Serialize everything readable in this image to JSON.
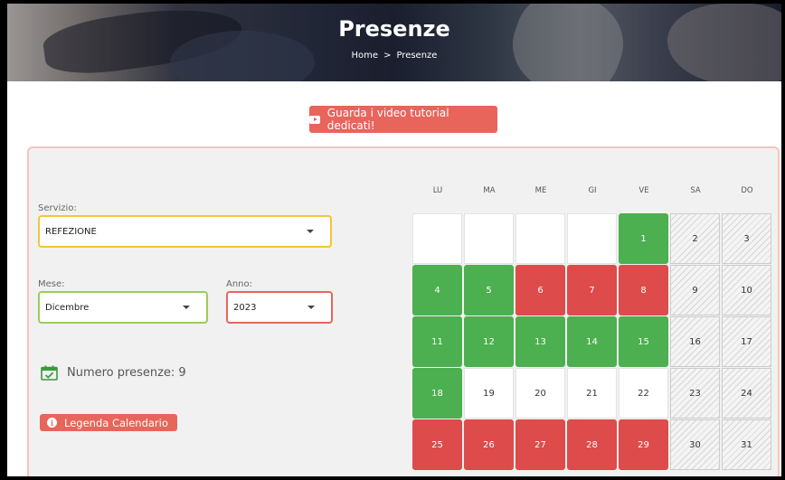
{
  "hero": {
    "title": "Presenze",
    "breadcrumb": {
      "home": "Home",
      "separator": ">",
      "current": "Presenze"
    }
  },
  "tutorial_button": {
    "label": "Guarda i video tutorial dedicati!",
    "icon": "youtube-icon"
  },
  "form": {
    "servizio": {
      "label": "Servizio:",
      "value": "REFEZIONE"
    },
    "mese": {
      "label": "Mese:",
      "value": "Dicembre"
    },
    "anno": {
      "label": "Anno:",
      "value": "2023"
    }
  },
  "presenze": {
    "text": "Numero presenze: 9",
    "icon": "calendar-check-icon"
  },
  "legend_button": {
    "label": "Legenda Calendario",
    "icon": "info-icon"
  },
  "colors": {
    "accent": "#e8655b",
    "present": "#4caf50",
    "absent": "#dd4b4b",
    "servizio_border": "#f5c33b",
    "mese_border": "#9acd5a",
    "anno_border": "#e8655b",
    "card_border": "#f6c5bd"
  },
  "calendar": {
    "weekdays": [
      "LU",
      "MA",
      "ME",
      "GI",
      "VE",
      "SA",
      "DO"
    ],
    "weeks": [
      [
        {
          "d": "",
          "s": "empty"
        },
        {
          "d": "",
          "s": "empty"
        },
        {
          "d": "",
          "s": "empty"
        },
        {
          "d": "",
          "s": "empty"
        },
        {
          "d": "1",
          "s": "green"
        },
        {
          "d": "2",
          "s": "weekend"
        },
        {
          "d": "3",
          "s": "weekend"
        }
      ],
      [
        {
          "d": "4",
          "s": "green"
        },
        {
          "d": "5",
          "s": "green"
        },
        {
          "d": "6",
          "s": "red"
        },
        {
          "d": "7",
          "s": "red"
        },
        {
          "d": "8",
          "s": "red"
        },
        {
          "d": "9",
          "s": "weekend"
        },
        {
          "d": "10",
          "s": "weekend"
        }
      ],
      [
        {
          "d": "11",
          "s": "green"
        },
        {
          "d": "12",
          "s": "green"
        },
        {
          "d": "13",
          "s": "green"
        },
        {
          "d": "14",
          "s": "green"
        },
        {
          "d": "15",
          "s": "green"
        },
        {
          "d": "16",
          "s": "weekend"
        },
        {
          "d": "17",
          "s": "weekend"
        }
      ],
      [
        {
          "d": "18",
          "s": "green"
        },
        {
          "d": "19",
          "s": "plain"
        },
        {
          "d": "20",
          "s": "plain"
        },
        {
          "d": "21",
          "s": "plain"
        },
        {
          "d": "22",
          "s": "plain"
        },
        {
          "d": "23",
          "s": "weekend"
        },
        {
          "d": "24",
          "s": "weekend"
        }
      ],
      [
        {
          "d": "25",
          "s": "red"
        },
        {
          "d": "26",
          "s": "red"
        },
        {
          "d": "27",
          "s": "red"
        },
        {
          "d": "28",
          "s": "red"
        },
        {
          "d": "29",
          "s": "red"
        },
        {
          "d": "30",
          "s": "weekend"
        },
        {
          "d": "31",
          "s": "weekend"
        }
      ]
    ]
  }
}
